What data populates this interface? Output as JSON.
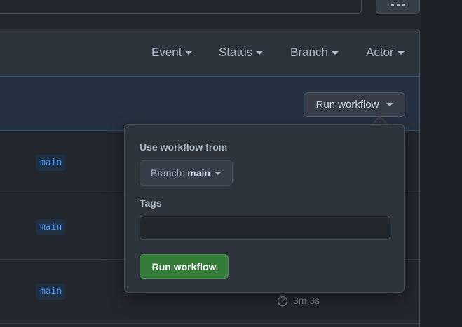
{
  "filters": [
    "Event",
    "Status",
    "Branch",
    "Actor"
  ],
  "run_workflow_button": "Run workflow",
  "rows": [
    {
      "branch": "main"
    },
    {
      "branch": "main"
    },
    {
      "branch": "main",
      "duration": "3m 3s"
    }
  ],
  "popover": {
    "use_from_label": "Use workflow from",
    "branch_prefix": "Branch:",
    "branch_value": "main",
    "tags_label": "Tags",
    "tags_value": "",
    "submit_label": "Run workflow"
  },
  "icons": {
    "kebab": "kebab-horizontal-icon",
    "caret": "triangle-down-icon",
    "timer": "stopwatch-icon"
  },
  "colors": {
    "accent_blue": "#539bf5",
    "success_green": "#347d39",
    "background": "#22272e"
  }
}
